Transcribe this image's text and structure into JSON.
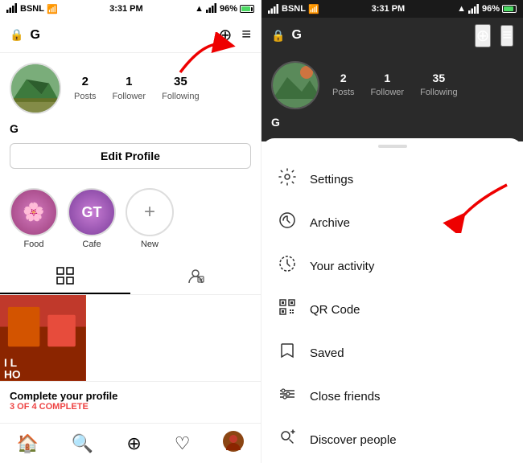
{
  "left": {
    "statusBar": {
      "carrier": "BSNL",
      "time": "3:31 PM",
      "battery": "96%"
    },
    "topNav": {
      "lockIcon": "🔒",
      "username": "G",
      "addIcon": "⊕",
      "menuIcon": "≡"
    },
    "profile": {
      "stats": [
        {
          "number": "2",
          "label": "Posts"
        },
        {
          "number": "1",
          "label": "Follower"
        },
        {
          "number": "35",
          "label": "Following"
        }
      ],
      "username": "G",
      "editProfileLabel": "Edit Profile"
    },
    "highlights": [
      {
        "label": "Food",
        "type": "food"
      },
      {
        "label": "Cafe",
        "type": "cafe"
      },
      {
        "label": "New",
        "type": "new"
      }
    ],
    "tabs": [
      {
        "icon": "⊞",
        "active": true
      },
      {
        "icon": "👤",
        "active": false
      }
    ],
    "profileComplete": {
      "title": "Complete your profile",
      "subtitle": "3 OF 4 COMPLETE"
    },
    "bottomNav": [
      "🏠",
      "🔍",
      "⊕",
      "♡",
      "👤"
    ]
  },
  "right": {
    "statusBar": {
      "carrier": "BSNL",
      "time": "3:31 PM",
      "battery": "96%"
    },
    "topNav": {
      "lockIcon": "🔒",
      "username": "G"
    },
    "profile": {
      "stats": [
        {
          "number": "2",
          "label": "Posts"
        },
        {
          "number": "1",
          "label": "Follower"
        },
        {
          "number": "35",
          "label": "Following"
        }
      ],
      "username": "G"
    },
    "menu": {
      "items": [
        {
          "icon": "⚙",
          "label": "Settings"
        },
        {
          "icon": "🕐",
          "label": "Archive"
        },
        {
          "icon": "🕓",
          "label": "Your activity"
        },
        {
          "icon": "⊞",
          "label": "QR Code"
        },
        {
          "icon": "🔖",
          "label": "Saved"
        },
        {
          "icon": "★",
          "label": "Close friends"
        },
        {
          "icon": "+👤",
          "label": "Discover people"
        }
      ]
    }
  }
}
